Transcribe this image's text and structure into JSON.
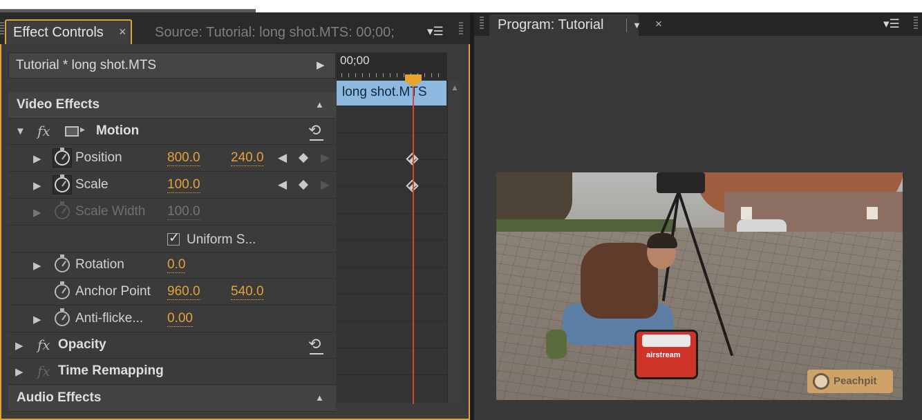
{
  "effect_controls": {
    "tab_label": "Effect Controls",
    "tab_close": "×",
    "source_tab_label": "Source: Tutorial: long shot.MTS: 00;00;",
    "panel_menu": "▾☰",
    "clip_header": "Tutorial * long shot.MTS",
    "timecode": "00;00",
    "clip_name": "long shot.MTS",
    "video_effects_label": "Video Effects",
    "audio_effects_label": "Audio Effects",
    "fx_symbol": "fx",
    "motion": {
      "label": "Motion",
      "properties": [
        {
          "label": "Position",
          "value1": "800.0",
          "value2": "240.0"
        },
        {
          "label": "Scale",
          "value1": "100.0"
        },
        {
          "label": "Scale Width",
          "value1": "100.0"
        },
        {
          "label": "Uniform S..."
        },
        {
          "label": "Rotation",
          "value1": "0.0"
        },
        {
          "label": "Anchor Point",
          "value1": "960.0",
          "value2": "540.0"
        },
        {
          "label": "Anti-flicke...",
          "value1": "0.00"
        }
      ]
    },
    "opacity_label": "Opacity",
    "time_remapping_label": "Time Remapping"
  },
  "program_monitor": {
    "tab_label": "Program: Tutorial",
    "tab_close": "×",
    "panel_menu": "▾☰",
    "bag_brand": "airstream",
    "watermark": "Peachpit"
  },
  "colors": {
    "accent_orange": "#e2a336",
    "value_orange": "#e5a237",
    "playhead_red": "#d8453a",
    "clip_blue": "#8db8df"
  }
}
